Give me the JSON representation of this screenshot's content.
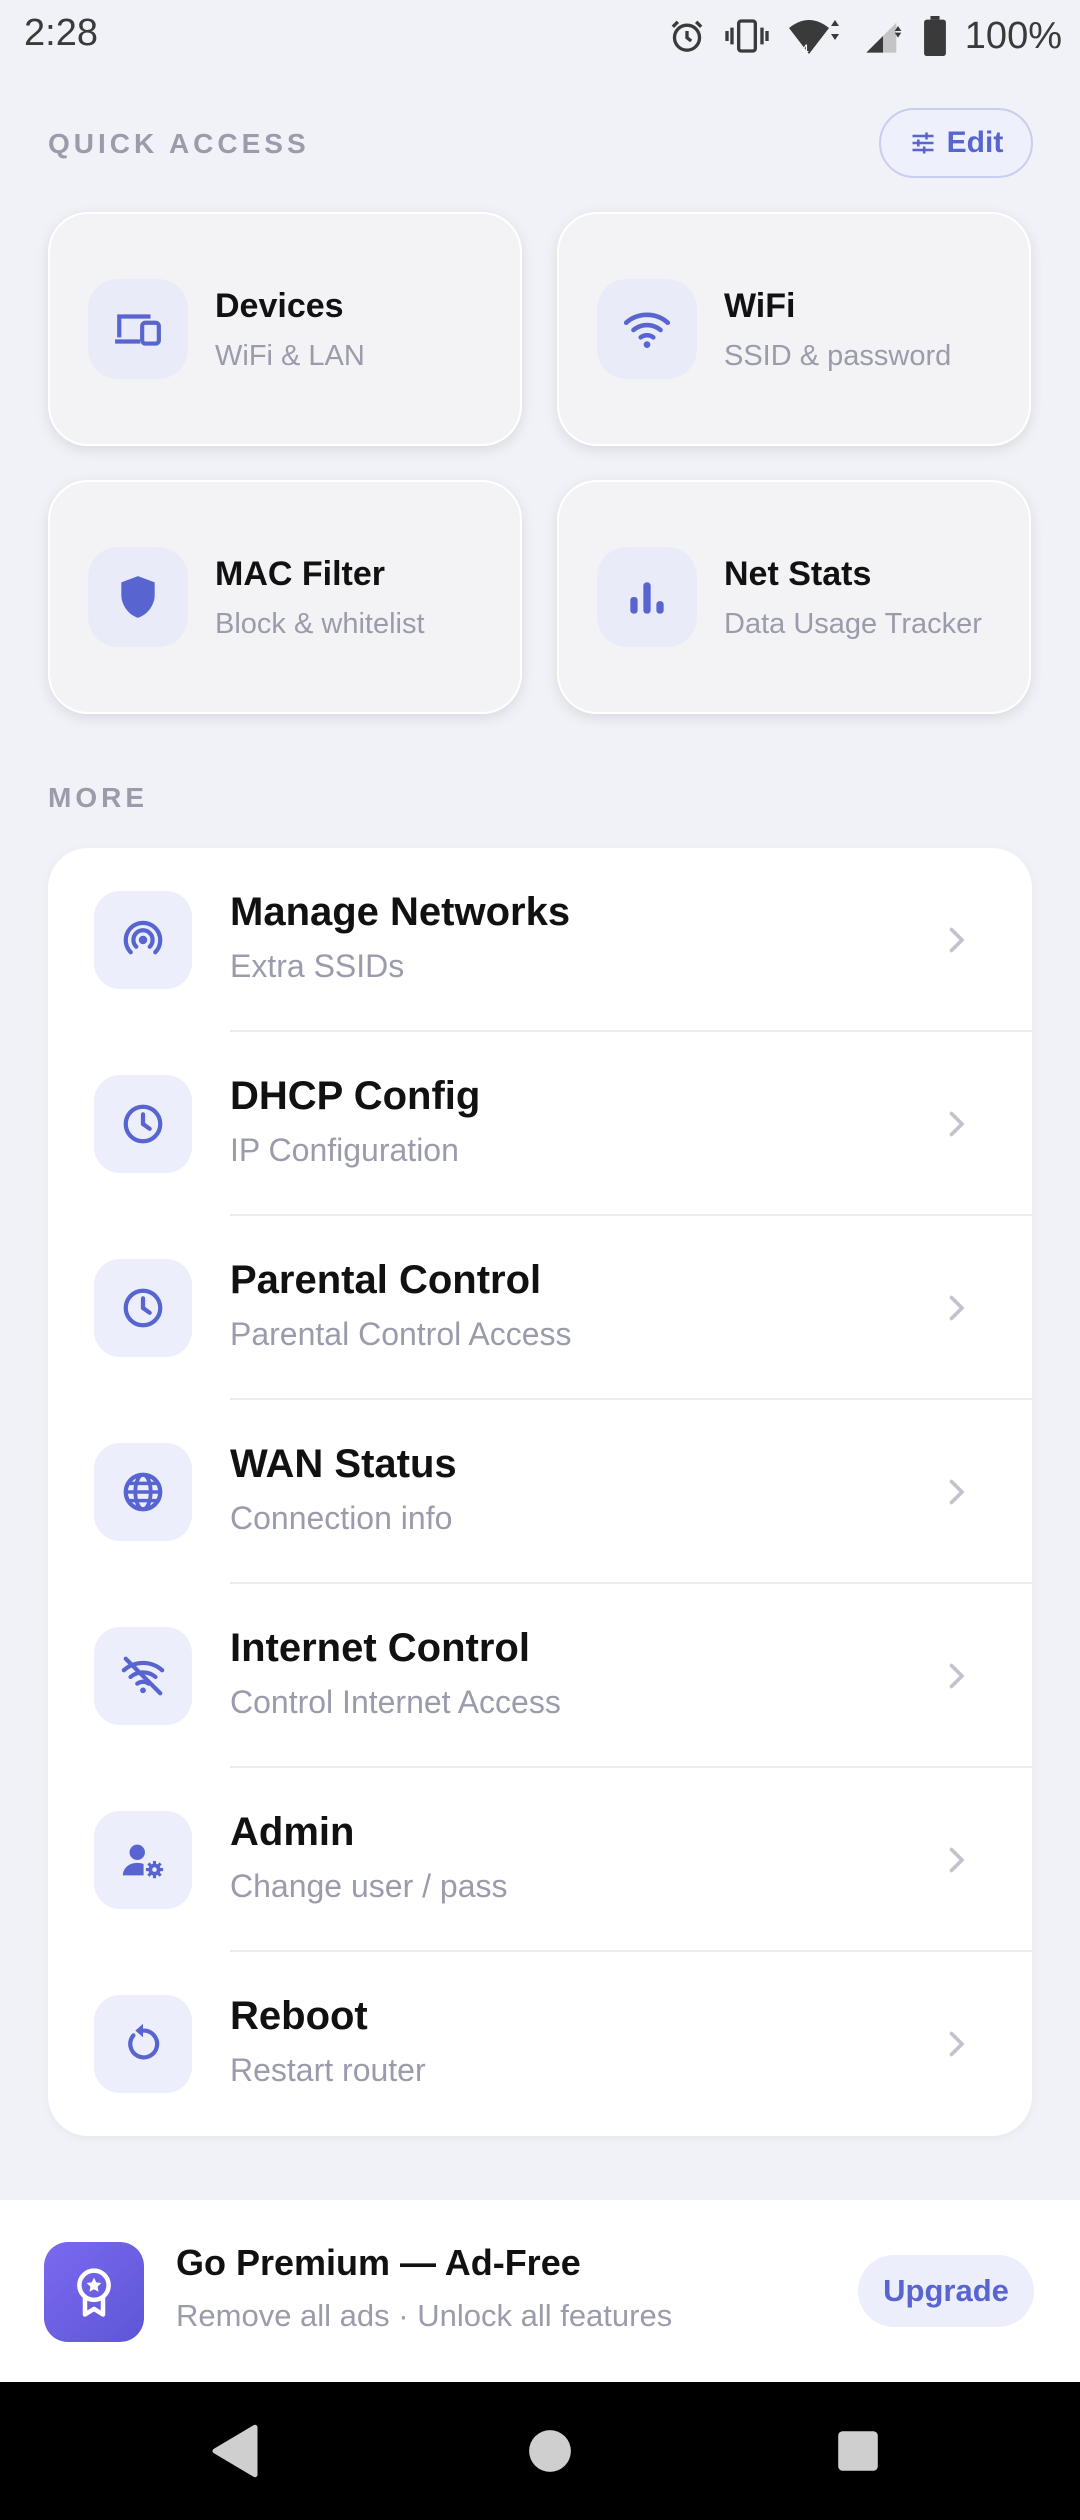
{
  "status_bar": {
    "time": "2:28",
    "battery": "100%",
    "icons": [
      "alarm-icon",
      "vibrate-icon",
      "wifi-icon",
      "cell-signal-icon",
      "battery-icon"
    ]
  },
  "quick_access": {
    "label": "QUICK ACCESS",
    "edit_label": "Edit",
    "cards": [
      {
        "title": "Devices",
        "subtitle": "WiFi & LAN",
        "icon": "devices-icon"
      },
      {
        "title": "WiFi",
        "subtitle": "SSID & password",
        "icon": "wifi-icon"
      },
      {
        "title": "MAC Filter",
        "subtitle": "Block & whitelist",
        "icon": "shield-icon"
      },
      {
        "title": "Net Stats",
        "subtitle": "Data Usage Tracker",
        "icon": "bar-chart-icon"
      }
    ]
  },
  "more": {
    "label": "MORE",
    "items": [
      {
        "title": "Manage Networks",
        "subtitle": "Extra SSIDs",
        "icon": "broadcast-icon"
      },
      {
        "title": "DHCP Config",
        "subtitle": "IP Configuration",
        "icon": "clock-icon"
      },
      {
        "title": "Parental Control",
        "subtitle": "Parental Control Access",
        "icon": "clock-icon"
      },
      {
        "title": "WAN Status",
        "subtitle": "Connection info",
        "icon": "globe-icon"
      },
      {
        "title": "Internet Control",
        "subtitle": "Control Internet Access",
        "icon": "wifi-off-icon"
      },
      {
        "title": "Admin",
        "subtitle": "Change user / pass",
        "icon": "user-settings-icon"
      },
      {
        "title": "Reboot",
        "subtitle": "Restart router",
        "icon": "refresh-icon"
      }
    ]
  },
  "premium": {
    "title": "Go Premium — Ad-Free",
    "subtitle": "Remove all ads · Unlock all features",
    "button": "Upgrade",
    "icon": "award-badge-icon"
  },
  "nav_bar": {
    "buttons": [
      "back-icon",
      "home-icon",
      "recents-icon"
    ]
  },
  "colors": {
    "accent": "#5864d0",
    "background": "#f1f2f7",
    "icon_bg": "#eceefb",
    "subtitle": "#9a9cab"
  }
}
